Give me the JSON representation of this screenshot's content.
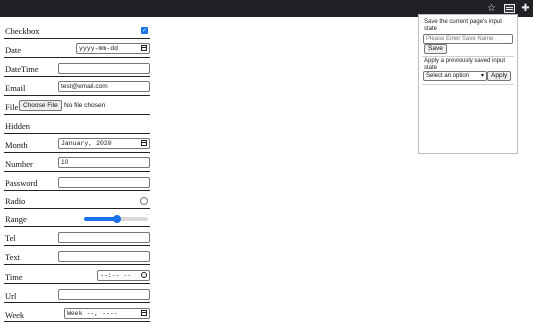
{
  "toolbar": {
    "icons": [
      "star-icon",
      "extension-icon",
      "puzzle-icon"
    ]
  },
  "form": {
    "rows": [
      {
        "label": "Checkbox",
        "checked": true
      },
      {
        "label": "Date",
        "value": "yyyy-mm-dd"
      },
      {
        "label": "DateTime",
        "value": ""
      },
      {
        "label": "Email",
        "value": "test@email.com"
      },
      {
        "label": "File",
        "button": "Choose File",
        "status": "No file chosen"
      },
      {
        "label": "Hidden"
      },
      {
        "label": "Month",
        "value": "January, 2020"
      },
      {
        "label": "Number",
        "value": "10"
      },
      {
        "label": "Password",
        "value": ""
      },
      {
        "label": "Radio",
        "checked": false
      },
      {
        "label": "Range",
        "value_fraction": 0.52
      },
      {
        "label": "Tel",
        "value": ""
      },
      {
        "label": "Text",
        "value": ""
      },
      {
        "label": "Time",
        "value": "--:-- --"
      },
      {
        "label": "Url",
        "value": ""
      },
      {
        "label": "Week",
        "value": "Week --, ----"
      }
    ]
  },
  "popup": {
    "save_heading": "Save the current page's input state",
    "save_placeholder": "Please Enter Save Name",
    "save_button": "Save",
    "apply_heading": "Apply a previously saved input state",
    "select_value": "Select an option",
    "apply_button": "Apply"
  }
}
